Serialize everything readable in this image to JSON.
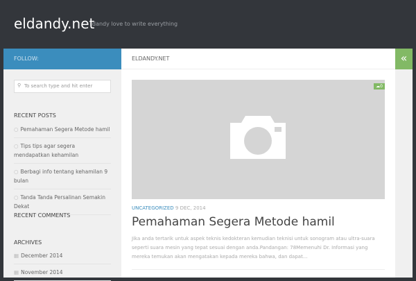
{
  "header": {
    "title": "eldandy.net",
    "tagline": "dandy love to write everything"
  },
  "sidebar": {
    "follow": "FOLLOW:",
    "search_placeholder": "To search type and hit enter",
    "recent_posts_title": "RECENT POSTS",
    "recent_posts": [
      "Pemahaman Segera Metode hamil",
      "Tips tips agar segera mendapatkan kehamilan",
      "Berbagi info tentang kehamilan 9 bulan",
      "Tanda Tanda Persalinan Semakin Dekat"
    ],
    "recent_comments_title": "RECENT COMMENTS",
    "archives_title": "ARCHIVES",
    "archives": [
      "December 2014",
      "November 2014"
    ]
  },
  "main": {
    "breadcrumb": "ELDANDY.NET",
    "post": {
      "comments": "0",
      "category": "UNCATEGORIZED",
      "date": "9 DEC, 2014",
      "title": "Pemahaman Segera Metode hamil",
      "excerpt": "Jika anda tertarik untuk aspek teknis kedokteran kemudian teknisi untuk sonogram atau ultra-suara seperti suara mesin yang tepat sesuai dengan anda.Pandangan: 78Memenuhi Dr. Informasi yang mereka temukan akan mengatakan kepada mereka bahwa, dan dapat..."
    }
  },
  "right": {
    "toggle_icon": "double-chevron-left"
  }
}
